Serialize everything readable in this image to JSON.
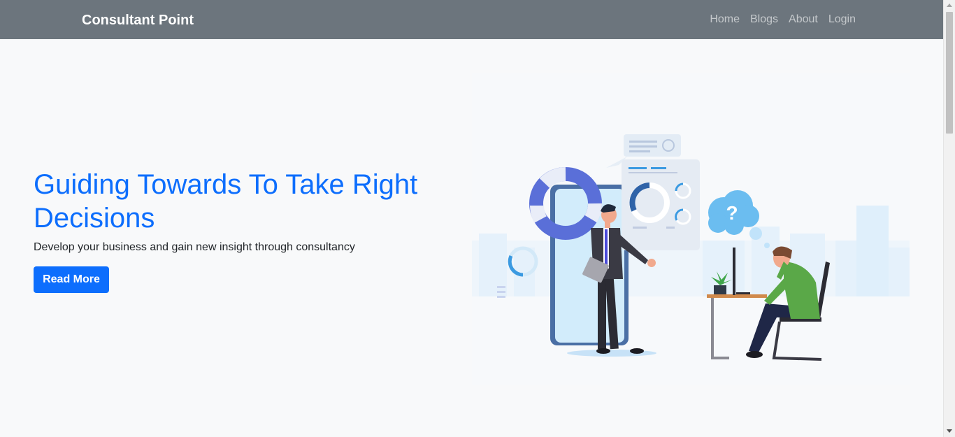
{
  "navbar": {
    "brand": "Consultant Point",
    "links": [
      "Home",
      "Blogs",
      "About",
      "Login"
    ]
  },
  "hero": {
    "title": "Guiding Towards To Take Right Decisions",
    "subtitle": "Develop your business and gain new insight through consultancy",
    "button_label": "Read More"
  },
  "illustration": {
    "bubble_text": "?"
  },
  "colors": {
    "navbar_bg": "#6c757d",
    "primary": "#0d6efd",
    "page_bg": "#f8f9fa"
  }
}
